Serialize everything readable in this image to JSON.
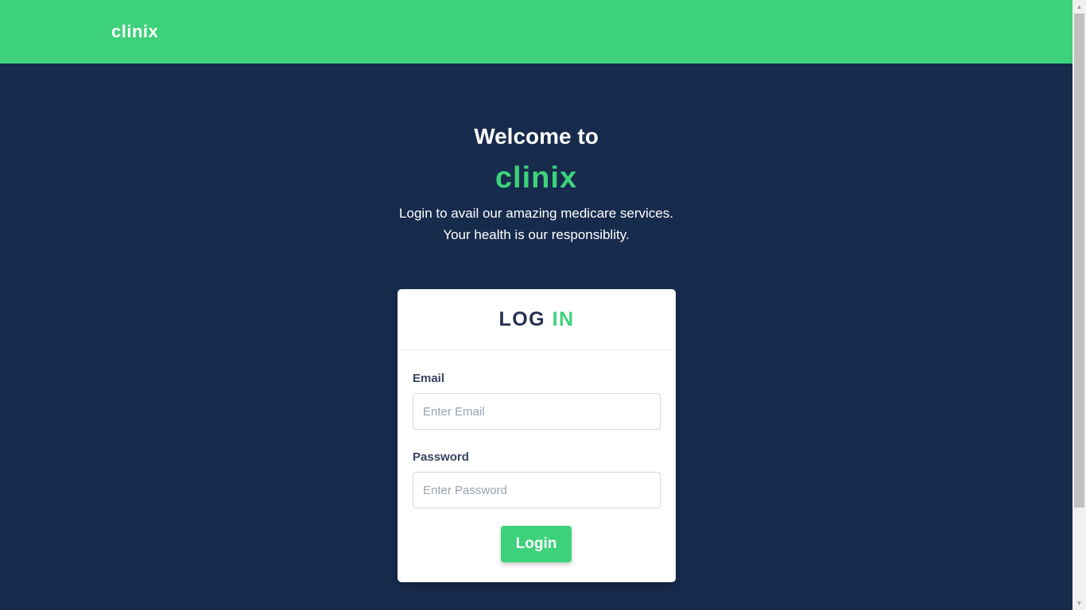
{
  "header": {
    "brand": "clinix"
  },
  "hero": {
    "welcome": "Welcome to",
    "brand": "clinix",
    "tagline_line1": "Login to avail our amazing medicare services.",
    "tagline_line2": "Your health is our responsiblity."
  },
  "login_card": {
    "title_part1": "LOG",
    "title_part2": "IN",
    "email_label": "Email",
    "email_placeholder": "Enter Email",
    "email_value": "",
    "password_label": "Password",
    "password_placeholder": "Enter Password",
    "password_value": "",
    "submit_label": "Login"
  },
  "scrollbar": {
    "up_icon": "scroll-up-arrow-icon",
    "down_icon": "scroll-down-arrow-icon"
  },
  "colors": {
    "brand_green": "#3dd27a",
    "background_navy": "#172b4d",
    "card_title_dark": "#25304f"
  }
}
